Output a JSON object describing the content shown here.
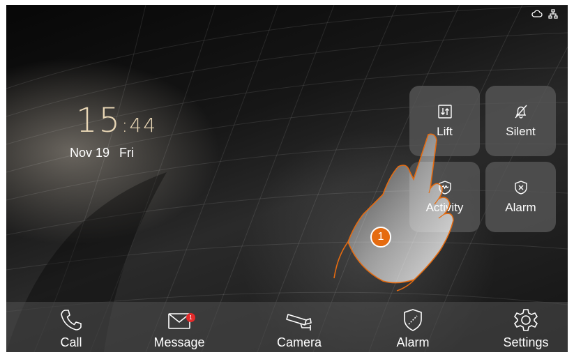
{
  "status": {
    "icons": [
      "cloud-icon",
      "network-icon"
    ]
  },
  "clock": {
    "hours": "15",
    "separator": ":",
    "minutes": "44"
  },
  "date": {
    "day": "Nov 19",
    "weekday": "Fri"
  },
  "tiles": [
    {
      "label": "Lift",
      "icon": "lift-icon"
    },
    {
      "label": "Silent",
      "icon": "bell-off-icon"
    },
    {
      "label": "Activity",
      "icon": "activity-shield-icon"
    },
    {
      "label": "Alarm",
      "icon": "alarm-shield-icon"
    }
  ],
  "step_badge": "1",
  "dock": {
    "items": [
      {
        "label": "Call",
        "icon": "phone-icon"
      },
      {
        "label": "Message",
        "icon": "envelope-icon",
        "badge": "1"
      },
      {
        "label": "Camera",
        "icon": "cctv-camera-icon"
      },
      {
        "label": "Alarm",
        "icon": "shield-icon"
      },
      {
        "label": "Settings",
        "icon": "gear-icon"
      }
    ]
  },
  "colors": {
    "accent": "#e56b10",
    "clock": "#e9d7b6",
    "badge": "#e52a2a"
  }
}
